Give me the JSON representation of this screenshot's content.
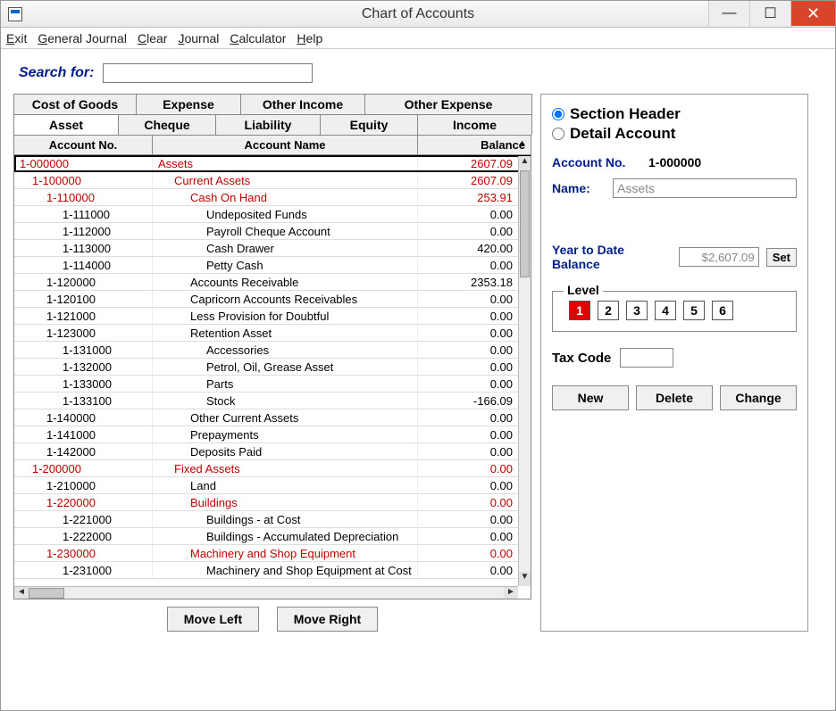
{
  "window": {
    "title": "Chart of Accounts"
  },
  "menubar": [
    "Exit",
    "General Journal",
    "Clear",
    "Journal",
    "Calculator",
    "Help"
  ],
  "search": {
    "label": "Search for:",
    "value": ""
  },
  "tabs_top": [
    "Cost of Goods",
    "Expense",
    "Other Income",
    "Other Expense"
  ],
  "tabs_bottom": [
    "Asset",
    "Cheque",
    "Liability",
    "Equity",
    "Income"
  ],
  "active_tab": "Asset",
  "columns": {
    "no": "Account No.",
    "name": "Account Name",
    "bal": "Balance"
  },
  "rows": [
    {
      "no": "1-000000",
      "name": "Assets",
      "bal": "2607.09",
      "red": true,
      "indent": 0,
      "selected": true
    },
    {
      "no": "1-100000",
      "name": "Current Assets",
      "bal": "2607.09",
      "red": true,
      "indent": 1
    },
    {
      "no": "1-110000",
      "name": "Cash On Hand",
      "bal": "253.91",
      "red": true,
      "indent": 2
    },
    {
      "no": "1-111000",
      "name": "Undeposited Funds",
      "bal": "0.00",
      "indent": 3
    },
    {
      "no": "1-112000",
      "name": "Payroll Cheque Account",
      "bal": "0.00",
      "indent": 3
    },
    {
      "no": "1-113000",
      "name": "Cash Drawer",
      "bal": "420.00",
      "indent": 3
    },
    {
      "no": "1-114000",
      "name": "Petty Cash",
      "bal": "0.00",
      "indent": 3
    },
    {
      "no": "1-120000",
      "name": "Accounts Receivable",
      "bal": "2353.18",
      "indent": 2
    },
    {
      "no": "1-120100",
      "name": "Capricorn Accounts Receivables",
      "bal": "0.00",
      "indent": 2
    },
    {
      "no": "1-121000",
      "name": "Less Provision for Doubtful",
      "bal": "0.00",
      "indent": 2
    },
    {
      "no": "1-123000",
      "name": "Retention Asset",
      "bal": "0.00",
      "indent": 2
    },
    {
      "no": "1-131000",
      "name": "Accessories",
      "bal": "0.00",
      "indent": 3
    },
    {
      "no": "1-132000",
      "name": "Petrol, Oil, Grease Asset",
      "bal": "0.00",
      "indent": 3
    },
    {
      "no": "1-133000",
      "name": "Parts",
      "bal": "0.00",
      "indent": 3
    },
    {
      "no": "1-133100",
      "name": "Stock",
      "bal": "-166.09",
      "indent": 3
    },
    {
      "no": "1-140000",
      "name": "Other Current Assets",
      "bal": "0.00",
      "indent": 2
    },
    {
      "no": "1-141000",
      "name": "Prepayments",
      "bal": "0.00",
      "indent": 2
    },
    {
      "no": "1-142000",
      "name": "Deposits Paid",
      "bal": "0.00",
      "indent": 2
    },
    {
      "no": "1-200000",
      "name": "Fixed Assets",
      "bal": "0.00",
      "red": true,
      "indent": 1
    },
    {
      "no": "1-210000",
      "name": "Land",
      "bal": "0.00",
      "indent": 2
    },
    {
      "no": "1-220000",
      "name": "Buildings",
      "bal": "0.00",
      "red": true,
      "indent": 2
    },
    {
      "no": "1-221000",
      "name": "Buildings - at Cost",
      "bal": "0.00",
      "indent": 3
    },
    {
      "no": "1-222000",
      "name": "Buildings - Accumulated Depreciation",
      "bal": "0.00",
      "indent": 3
    },
    {
      "no": "1-230000",
      "name": "Machinery and Shop Equipment",
      "bal": "0.00",
      "red": true,
      "indent": 2
    },
    {
      "no": "1-231000",
      "name": "Machinery and Shop Equipment at Cost",
      "bal": "0.00",
      "indent": 3
    }
  ],
  "move": {
    "left": "Move Left",
    "right": "Move Right"
  },
  "detail": {
    "type_header": "Section Header",
    "type_detail": "Detail Account",
    "selected_type": "header",
    "acct_no_label": "Account No.",
    "acct_no": "1-000000",
    "name_label": "Name:",
    "name_value": "Assets",
    "ytd_label": "Year to Date Balance",
    "ytd_value": "$2,607.09",
    "set_label": "Set",
    "level_label": "Level",
    "levels": [
      "1",
      "2",
      "3",
      "4",
      "5",
      "6"
    ],
    "level_selected": "1",
    "tax_label": "Tax Code",
    "tax_value": "",
    "btn_new": "New",
    "btn_delete": "Delete",
    "btn_change": "Change"
  }
}
